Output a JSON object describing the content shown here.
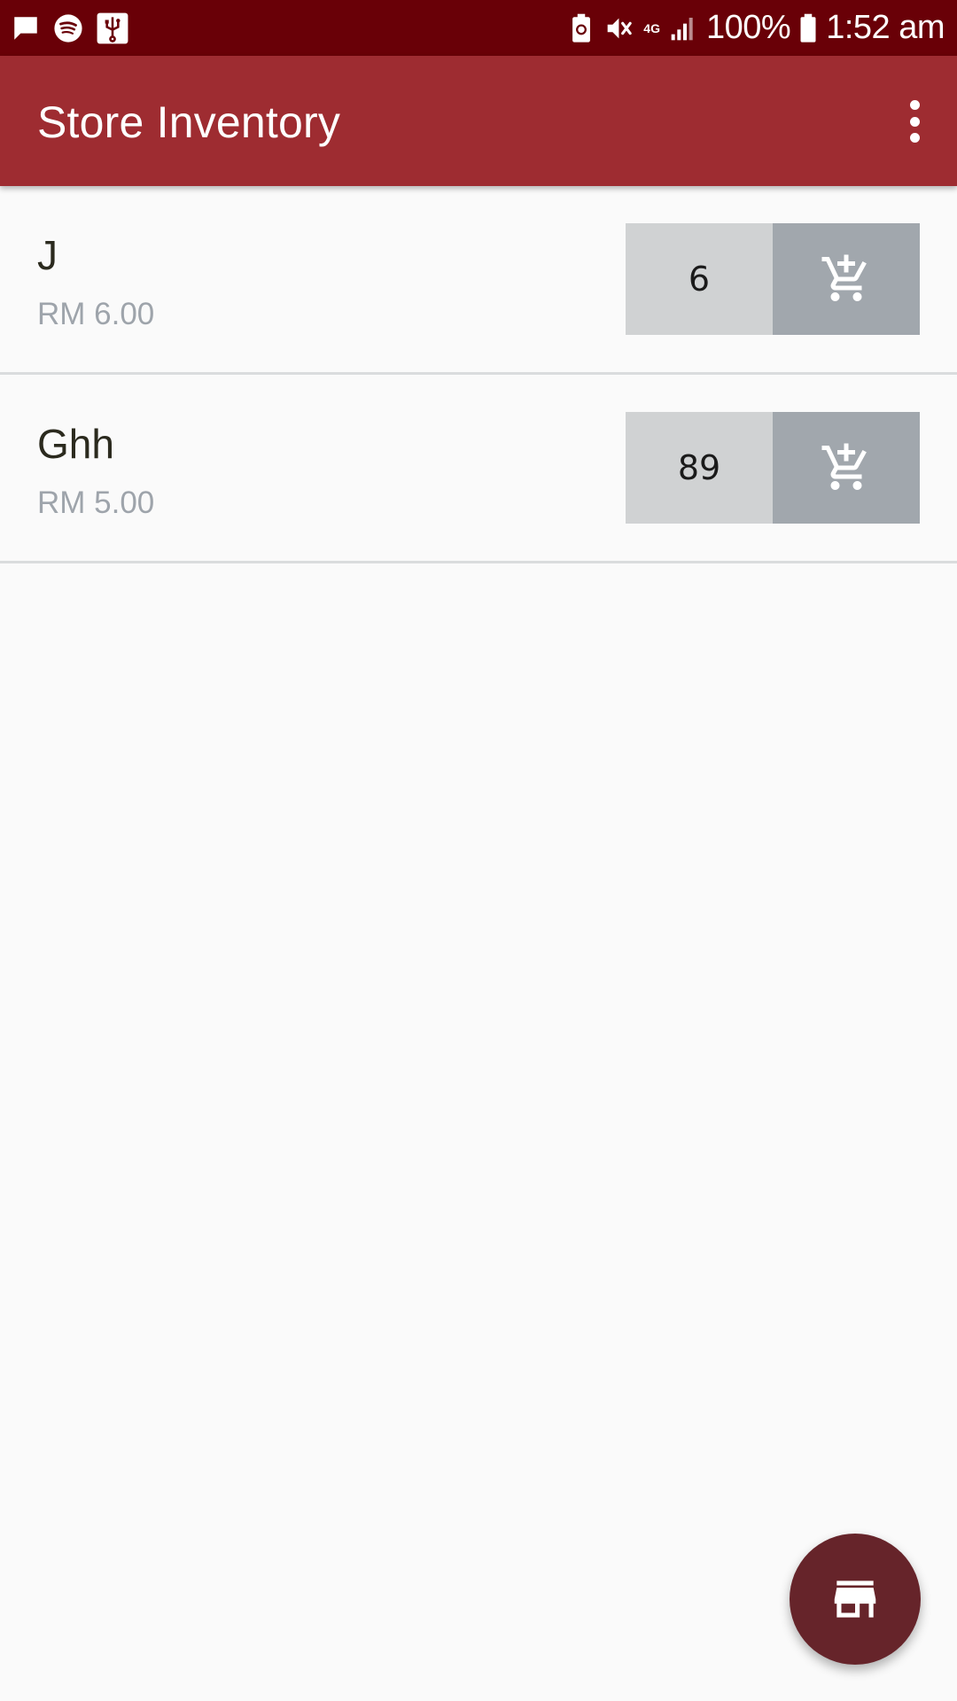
{
  "status_bar": {
    "left_icons": [
      "message-icon",
      "spotify-icon",
      "usb-icon"
    ],
    "right_icons": [
      "battery-saver-icon",
      "vibrate-mute-icon",
      "network-4g-icon",
      "signal-icon",
      "battery-icon"
    ],
    "network_type": "4G",
    "battery_level": "100%",
    "time": "1:52 am"
  },
  "app_bar": {
    "title": "Store Inventory",
    "overflow_icon": "more-vert-icon"
  },
  "items": [
    {
      "name": "J",
      "price": "RM 6.00",
      "quantity": "6",
      "action_icon": "add-shopping-cart-icon"
    },
    {
      "name": "Ghh",
      "price": "RM 5.00",
      "quantity": "89",
      "action_icon": "add-shopping-cart-icon"
    }
  ],
  "fab": {
    "icon": "store-icon"
  },
  "colors": {
    "status_bar": "#690007",
    "app_bar": "#9e2c31",
    "fab": "#66242a",
    "quantity_bg": "#d0d2d3",
    "cart_bg": "#a1a7ad",
    "price_text": "#9ea4ab",
    "background": "#fafafa"
  }
}
